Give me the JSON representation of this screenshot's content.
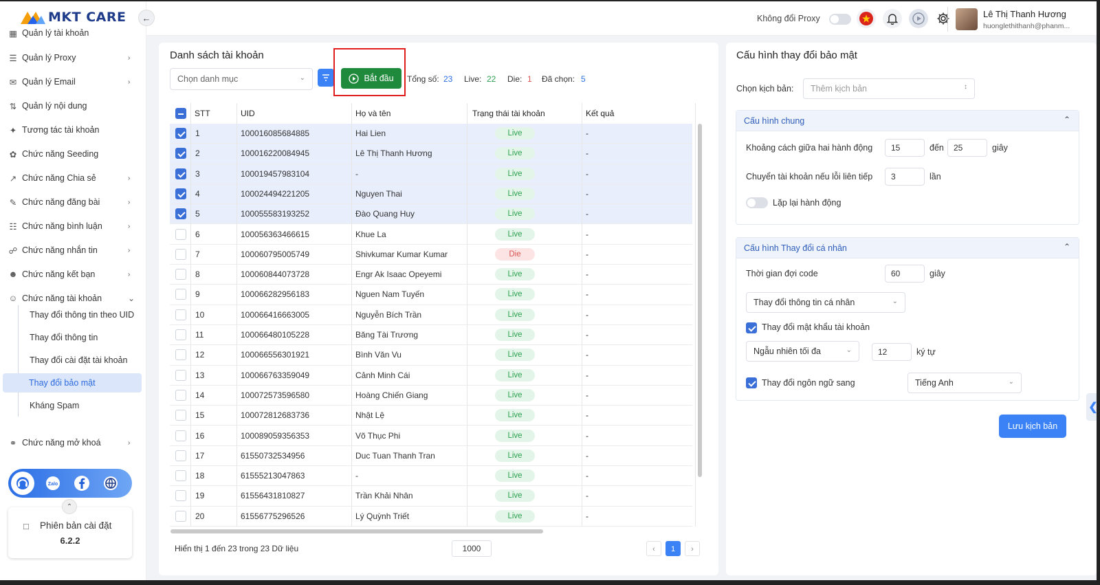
{
  "app": {
    "logo_text": "MKT CARE",
    "collapse_icon": "chevron-left-icon"
  },
  "sidebar": {
    "items": [
      {
        "label": "Quản lý tài khoản",
        "icon": "grid-icon",
        "has_chevron": false
      },
      {
        "label": "Quản lý Proxy",
        "icon": "layers-icon",
        "has_chevron": true
      },
      {
        "label": "Quản lý Email",
        "icon": "mail-icon",
        "has_chevron": true
      },
      {
        "label": "Quản lý nội dung",
        "icon": "content-icon",
        "has_chevron": false
      },
      {
        "label": "Tương tác tài khoản",
        "icon": "interact-icon",
        "has_chevron": false
      },
      {
        "label": "Chức năng Seeding",
        "icon": "seeding-icon",
        "has_chevron": false
      },
      {
        "label": "Chức năng Chia sẻ",
        "icon": "share-icon",
        "has_chevron": true
      },
      {
        "label": "Chức năng đăng bài",
        "icon": "post-icon",
        "has_chevron": true
      },
      {
        "label": "Chức năng bình luận",
        "icon": "comment-icon",
        "has_chevron": true
      },
      {
        "label": "Chức năng nhắn tin",
        "icon": "message-icon",
        "has_chevron": true
      },
      {
        "label": "Chức năng kết bạn",
        "icon": "add-friend-icon",
        "has_chevron": true
      },
      {
        "label": "Chức năng tài khoản",
        "icon": "account-icon",
        "has_chevron": true
      },
      {
        "label": "Chức năng mở khoá",
        "icon": "unlock-icon",
        "has_chevron": true
      }
    ],
    "sub_items": [
      {
        "label": "Thay đổi thông tin theo UID",
        "active": false
      },
      {
        "label": "Thay đổi thông tin",
        "active": false
      },
      {
        "label": "Thay đổi cài đặt tài khoản",
        "active": false
      },
      {
        "label": "Thay đổi bảo mật",
        "active": true
      },
      {
        "label": "Kháng Spam",
        "active": false
      }
    ],
    "social": [
      "support-icon",
      "zalo-icon",
      "facebook-icon",
      "globe-icon"
    ],
    "version_label": "Phiên bản cài đặt",
    "version_value": "6.2.2"
  },
  "header": {
    "proxy_label": "Không đổi Proxy",
    "user_name": "Lê Thị Thanh Hương",
    "user_email": "huonglethithanh@phanm..."
  },
  "accounts": {
    "title": "Danh sách tài khoản",
    "category_placeholder": "Chọn danh mục",
    "start_label": "Bắt đầu",
    "stats": {
      "total_label": "Tổng số:",
      "total_value": "23",
      "live_label": "Live:",
      "live_value": "22",
      "die_label": "Die:",
      "die_value": "1",
      "selected_label": "Đã chọn:",
      "selected_value": "5"
    },
    "columns": [
      "STT",
      "UID",
      "Họ và tên",
      "Trạng thái tài khoản",
      "Kết quả"
    ],
    "rows": [
      {
        "stt": "1",
        "uid": "100016085684885",
        "name": "Hai Lien",
        "status": "Live",
        "result": "-",
        "selected": true
      },
      {
        "stt": "2",
        "uid": "100016220084945",
        "name": "Lê Thị Thanh Hương",
        "status": "Live",
        "result": "-",
        "selected": true
      },
      {
        "stt": "3",
        "uid": "100019457983104",
        "name": "-",
        "status": "Live",
        "result": "-",
        "selected": true
      },
      {
        "stt": "4",
        "uid": "100024494221205",
        "name": "Nguyen Thai",
        "status": "Live",
        "result": "-",
        "selected": true
      },
      {
        "stt": "5",
        "uid": "100055583193252",
        "name": "Đào Quang Huy",
        "status": "Live",
        "result": "-",
        "selected": true
      },
      {
        "stt": "6",
        "uid": "100056363466615",
        "name": "Khue La",
        "status": "Live",
        "result": "-",
        "selected": false
      },
      {
        "stt": "7",
        "uid": "100060795005749",
        "name": "Shivkumar Kumar Kumar",
        "status": "Die",
        "result": "-",
        "selected": false
      },
      {
        "stt": "8",
        "uid": "100060844073728",
        "name": "Engr Ak Isaac Opeyemi",
        "status": "Live",
        "result": "-",
        "selected": false
      },
      {
        "stt": "9",
        "uid": "100066282956183",
        "name": "Nguen Nam Tuyến",
        "status": "Live",
        "result": "-",
        "selected": false
      },
      {
        "stt": "10",
        "uid": "100066416663005",
        "name": "Nguyễn Bích Trần",
        "status": "Live",
        "result": "-",
        "selected": false
      },
      {
        "stt": "11",
        "uid": "100066480105228",
        "name": "Băng Tài Trương",
        "status": "Live",
        "result": "-",
        "selected": false
      },
      {
        "stt": "12",
        "uid": "100066556301921",
        "name": "Bình Văn Vu",
        "status": "Live",
        "result": "-",
        "selected": false
      },
      {
        "stt": "13",
        "uid": "100066763359049",
        "name": "Cảnh Minh Cái",
        "status": "Live",
        "result": "-",
        "selected": false
      },
      {
        "stt": "14",
        "uid": "100072573596580",
        "name": "Hoàng Chiến Giang",
        "status": "Live",
        "result": "-",
        "selected": false
      },
      {
        "stt": "15",
        "uid": "100072812683736",
        "name": "Nhật Lệ",
        "status": "Live",
        "result": "-",
        "selected": false
      },
      {
        "stt": "16",
        "uid": "100089059356353",
        "name": "Võ Thục Phi",
        "status": "Live",
        "result": "-",
        "selected": false
      },
      {
        "stt": "17",
        "uid": "61550732534956",
        "name": "Duc Tuan Thanh Tran",
        "status": "Live",
        "result": "-",
        "selected": false
      },
      {
        "stt": "18",
        "uid": "61555213047863",
        "name": "-",
        "status": "Live",
        "result": "-",
        "selected": false
      },
      {
        "stt": "19",
        "uid": "61556431810827",
        "name": "Trần Khải Nhân",
        "status": "Live",
        "result": "-",
        "selected": false
      },
      {
        "stt": "20",
        "uid": "61556775296526",
        "name": "Lý Quỳnh Triết",
        "status": "Live",
        "result": "-",
        "selected": false
      }
    ],
    "footer_text": "Hiển thị 1 đến 23 trong 23 Dữ liệu",
    "page_size": "1000",
    "current_page": "1"
  },
  "config": {
    "title": "Cấu hình thay đổi bảo mật",
    "script_label": "Chọn kịch bản:",
    "script_placeholder": "Thêm kịch bản",
    "general": {
      "title": "Cấu hình chung",
      "delay_label": "Khoảng cách giữa hai hành động",
      "delay_from": "15",
      "to_label": "đến",
      "delay_to": "25",
      "seconds_label": "giây",
      "switch_label": "Chuyển tài khoản nếu lỗi liên tiếp",
      "switch_value": "3",
      "times_label": "lần",
      "repeat_label": "Lặp lại hành động"
    },
    "personal": {
      "title": "Cấu hình Thay đổi cá nhân",
      "wait_label": "Thời gian đợi code",
      "wait_value": "60",
      "seconds_label": "giây",
      "info_select": "Thay đổi thông tin cá nhân",
      "password_label": "Thay đổi mật khẩu tài khoản",
      "password_mode": "Ngẫu nhiên tối đa",
      "password_length": "12",
      "chars_label": "ký tự",
      "language_label": "Thay đổi ngôn ngữ sang",
      "language_value": "Tiếng Anh"
    },
    "save_label": "Lưu kịch bản"
  }
}
